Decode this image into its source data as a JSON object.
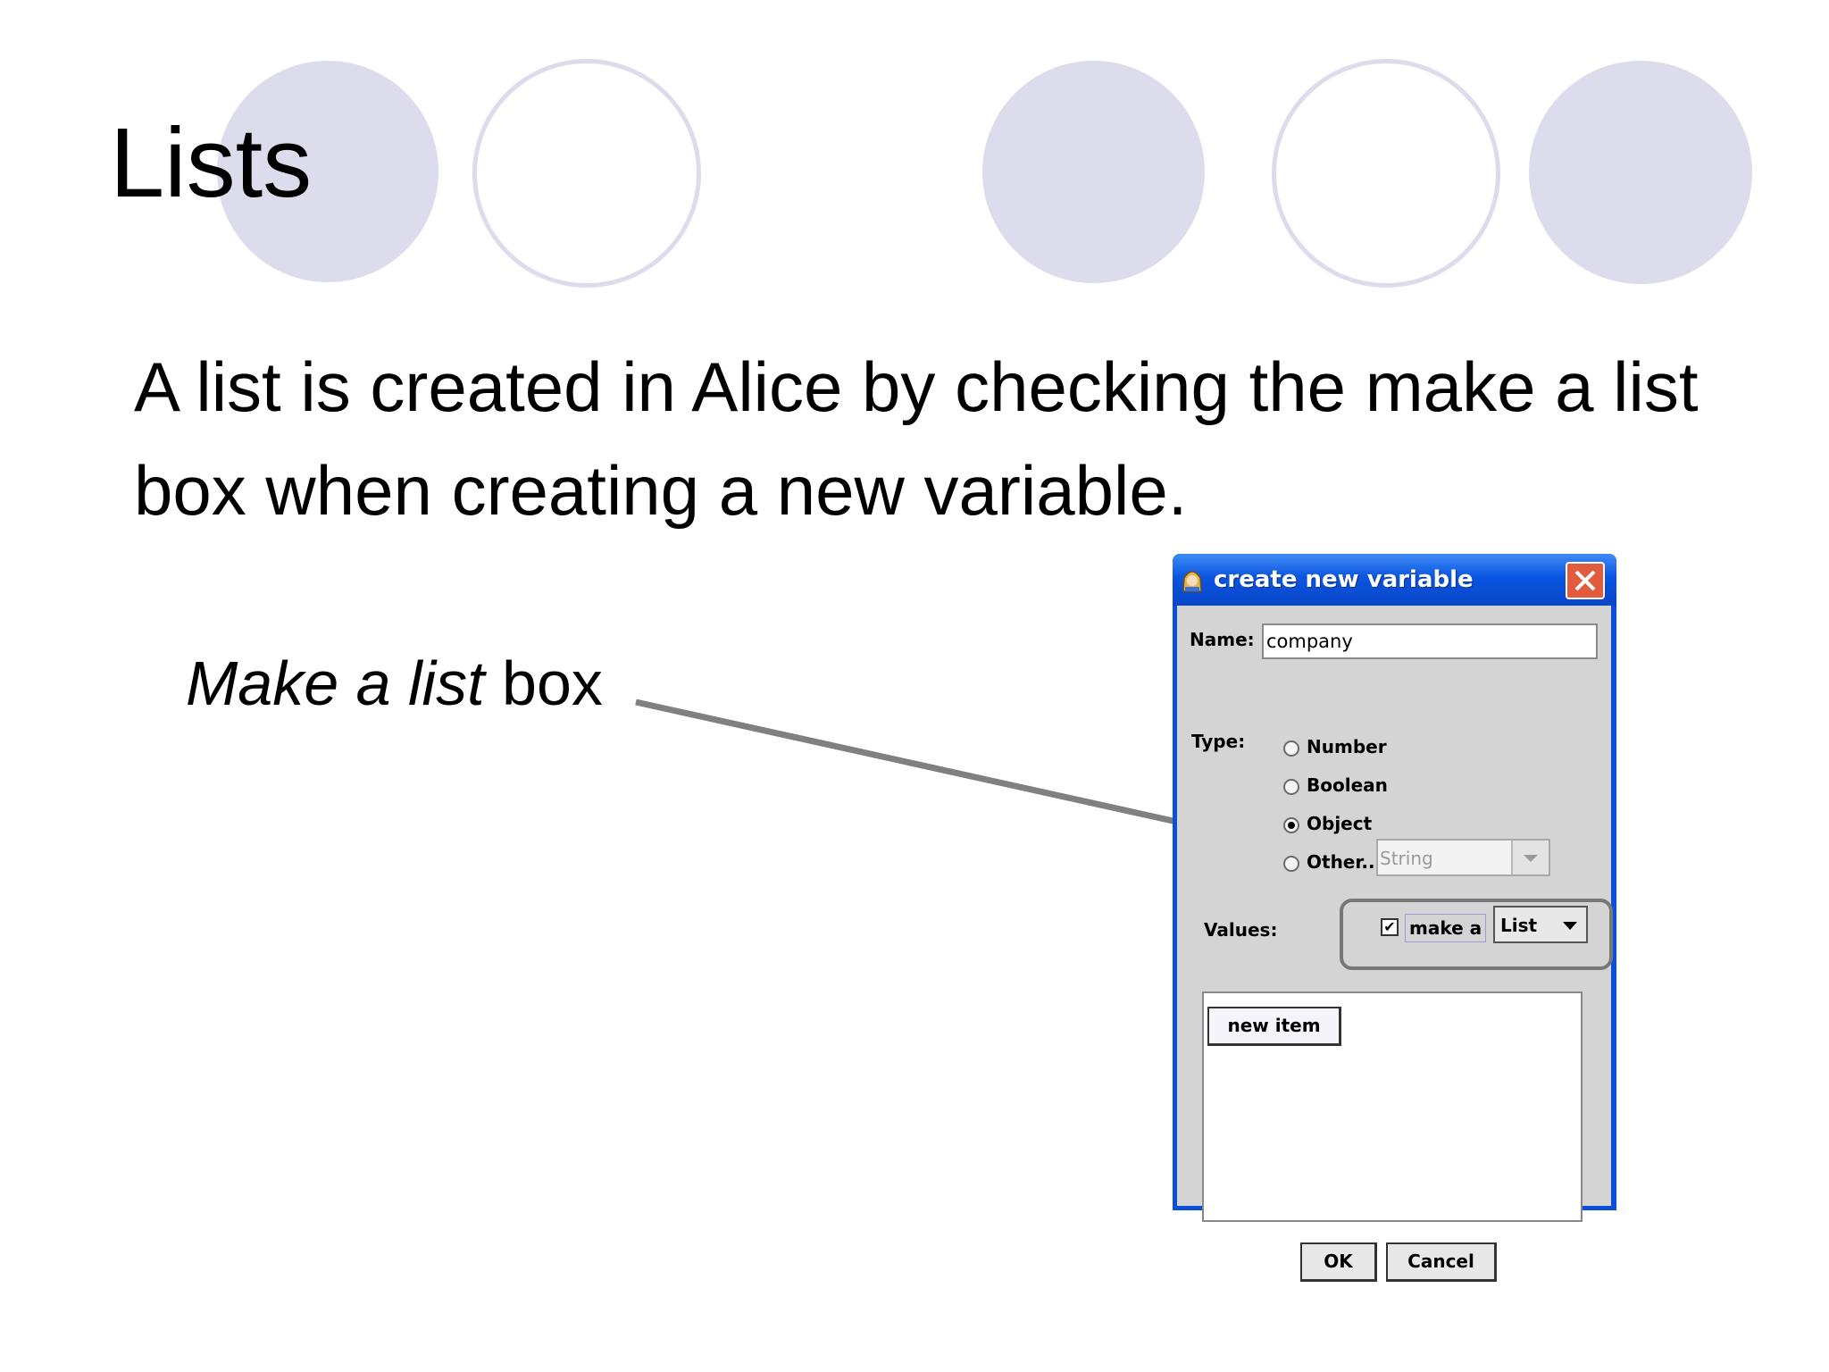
{
  "slide": {
    "title": "Lists",
    "body": "A list is created in Alice by checking the make a list box when creating a new variable.",
    "annotation_italic": "Make a list",
    "annotation_rest": " box"
  },
  "dialog": {
    "title": "create new variable",
    "name_label": "Name:",
    "name_value": "company",
    "type_label": "Type:",
    "types": [
      {
        "label": "Number",
        "selected": false
      },
      {
        "label": "Boolean",
        "selected": false
      },
      {
        "label": "Object",
        "selected": true
      },
      {
        "label": "Other...",
        "selected": false
      }
    ],
    "other_type_value": "String",
    "values_label": "Values:",
    "make_a_label": "make a",
    "make_a_checked": true,
    "check_mark": "✔",
    "collection_type": "List",
    "new_item_label": "new item",
    "ok_label": "OK",
    "cancel_label": "Cancel"
  },
  "colors": {
    "circle": "#dcdcec",
    "titlebar": "#0a55e0",
    "arrow": "#808080",
    "highlight": "#777777"
  }
}
